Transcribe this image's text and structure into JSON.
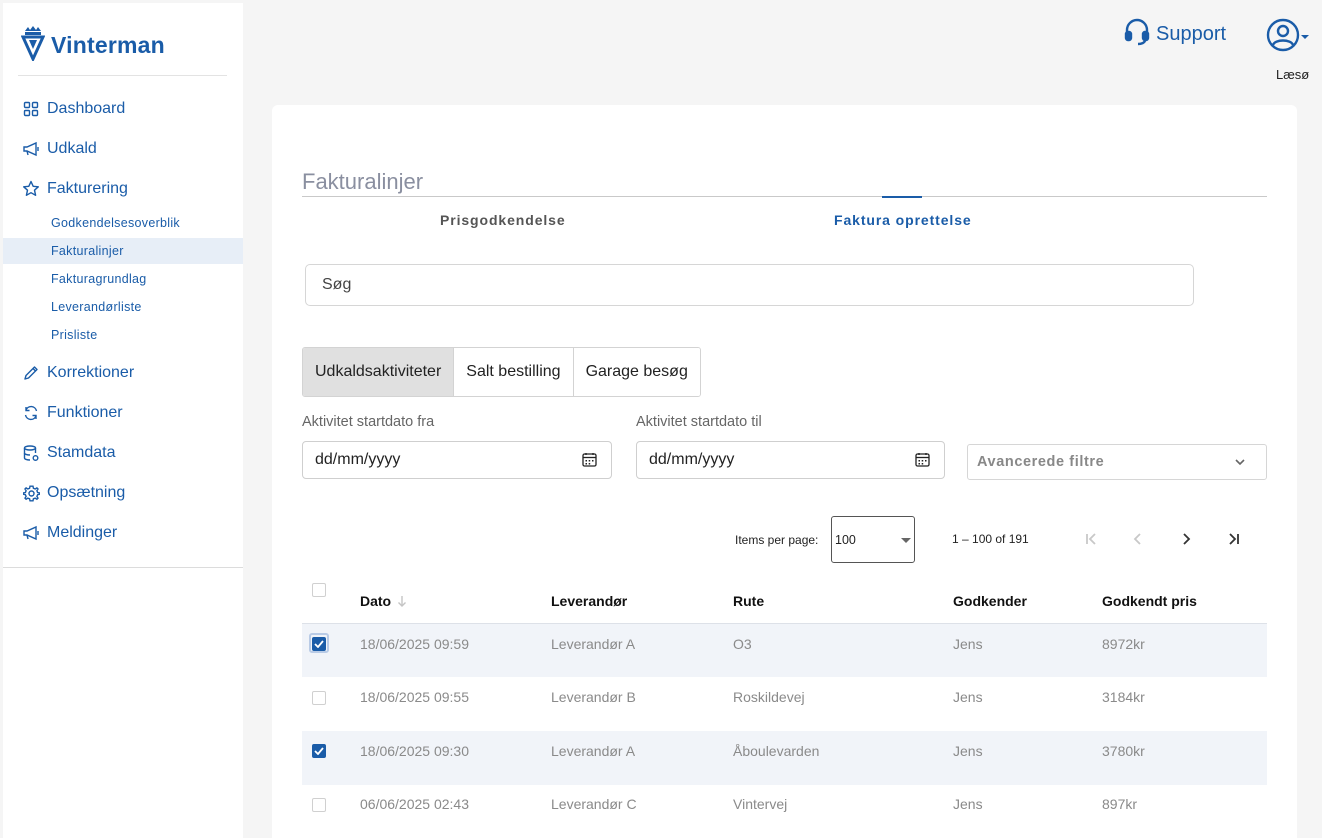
{
  "app": {
    "logo_text": "Vinterman"
  },
  "sidebar": {
    "items": [
      {
        "label": "Dashboard",
        "icon": "grid-icon"
      },
      {
        "label": "Udkald",
        "icon": "megaphone-icon"
      },
      {
        "label": "Fakturering",
        "icon": "star-icon"
      },
      {
        "label": "Korrektioner",
        "icon": "pencil-icon"
      },
      {
        "label": "Funktioner",
        "icon": "refresh-icon"
      },
      {
        "label": "Stamdata",
        "icon": "database-icon"
      },
      {
        "label": "Opsætning",
        "icon": "gear-icon"
      },
      {
        "label": "Meldinger",
        "icon": "megaphone-icon"
      }
    ],
    "sub_items": [
      {
        "label": "Godkendelsesoverblik"
      },
      {
        "label": "Fakturalinjer",
        "active": true
      },
      {
        "label": "Fakturagrundlag"
      },
      {
        "label": "Leverandørliste"
      },
      {
        "label": "Prisliste"
      }
    ]
  },
  "header": {
    "support_label": "Support",
    "user_name": "Læsø"
  },
  "main": {
    "title": "Fakturalinjer",
    "tabs": [
      {
        "label": "Prisgodkendelse"
      },
      {
        "label": "Faktura oprettelse",
        "active": true
      }
    ],
    "search_placeholder": "Søg",
    "segments": [
      {
        "label": "Udkaldsaktiviteter",
        "active": true
      },
      {
        "label": "Salt bestilling"
      },
      {
        "label": "Garage besøg"
      }
    ],
    "date_from": {
      "label": "Aktivitet startdato fra",
      "placeholder": "dd/mm/yyyy"
    },
    "date_to": {
      "label": "Aktivitet startdato til",
      "placeholder": "dd/mm/yyyy"
    },
    "advanced_filters_label": "Avancerede filtre",
    "paginator": {
      "items_per_page_label": "Items per page:",
      "items_per_page_value": "100",
      "range_label": "1 – 100 of 191"
    },
    "table": {
      "columns": [
        "Dato",
        "Leverandør",
        "Rute",
        "Godkender",
        "Godkendt pris"
      ],
      "rows": [
        {
          "checked": true,
          "dato": "18/06/2025 09:59",
          "leverandor": "Leverandør A",
          "rute": "O3",
          "godkender": "Jens",
          "pris": "8972kr"
        },
        {
          "checked": false,
          "dato": "18/06/2025 09:55",
          "leverandor": "Leverandør B",
          "rute": "Roskildevej",
          "godkender": "Jens",
          "pris": "3184kr"
        },
        {
          "checked": true,
          "dato": "18/06/2025 09:30",
          "leverandor": "Leverandør A",
          "rute": "Åboulevarden",
          "godkender": "Jens",
          "pris": "3780kr"
        },
        {
          "checked": false,
          "dato": "06/06/2025 02:43",
          "leverandor": "Leverandør C",
          "rute": "Vintervej",
          "godkender": "Jens",
          "pris": "897kr"
        }
      ]
    }
  },
  "colors": {
    "brand": "#1a5ca8"
  }
}
